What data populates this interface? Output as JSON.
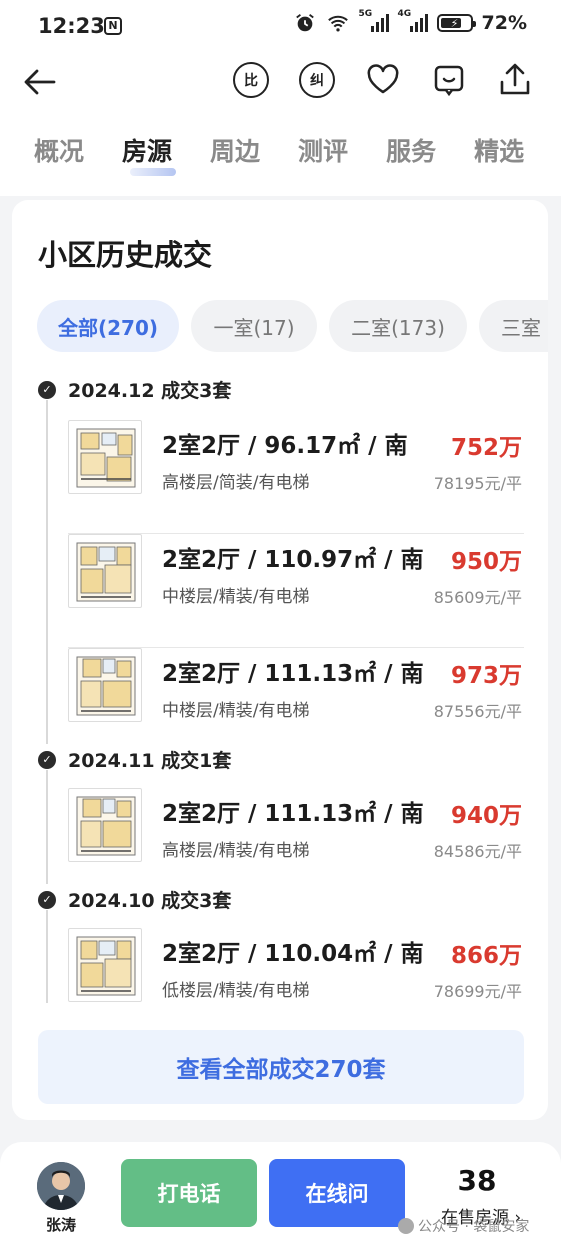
{
  "status_bar": {
    "time": "12:23",
    "nfc": "N",
    "signal1_label": "5G",
    "signal2_label": "4G",
    "battery_percent": "72%",
    "battery_level": 0.72
  },
  "nav": {
    "compare_label": "比",
    "correct_label": "纠"
  },
  "tabs": [
    "概况",
    "房源",
    "周边",
    "测评",
    "服务",
    "精选"
  ],
  "active_tab": "房源",
  "section": {
    "title": "小区历史成交",
    "chips": [
      {
        "label": "全部(270)",
        "active": true
      },
      {
        "label": "一室(17)",
        "active": false
      },
      {
        "label": "二室(173)",
        "active": false
      },
      {
        "label": "三室",
        "active": false
      }
    ],
    "groups": [
      {
        "heading": "2024.12 成交3套",
        "items": [
          {
            "room": "2室2厅 / 96.17㎡ / 南",
            "price": "752万",
            "tags": "高楼层/简装/有电梯",
            "unit_price": "78195元/平"
          },
          {
            "room": "2室2厅 / 110.97㎡ / 南",
            "price": "950万",
            "tags": "中楼层/精装/有电梯",
            "unit_price": "85609元/平"
          },
          {
            "room": "2室2厅 / 111.13㎡ / 南",
            "price": "973万",
            "tags": "中楼层/精装/有电梯",
            "unit_price": "87556元/平"
          }
        ]
      },
      {
        "heading": "2024.11 成交1套",
        "items": [
          {
            "room": "2室2厅 / 111.13㎡ / 南",
            "price": "940万",
            "tags": "高楼层/精装/有电梯",
            "unit_price": "84586元/平"
          }
        ]
      },
      {
        "heading": "2024.10 成交3套",
        "items": [
          {
            "room": "2室2厅 / 110.04㎡ / 南",
            "price": "866万",
            "tags": "低楼层/精装/有电梯",
            "unit_price": "78699元/平"
          }
        ]
      }
    ],
    "view_all_label": "查看全部成交270套"
  },
  "bottom_bar": {
    "agent_name": "张涛",
    "call_label": "打电话",
    "chat_label": "在线问",
    "for_sale_count": "38",
    "for_sale_label": "在售房源 ›"
  },
  "watermark": "公众号 · 袋鼠安家",
  "colors": {
    "accent_blue": "#3e6de0",
    "price_red": "#d93a2f",
    "call_green": "#63be86",
    "chat_blue": "#3f6ff3"
  }
}
